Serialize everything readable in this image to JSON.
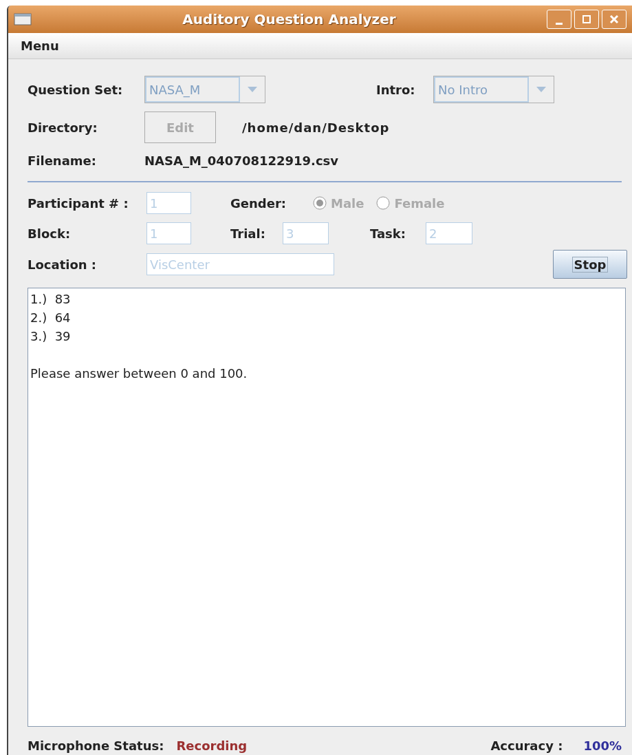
{
  "window": {
    "title": "Auditory Question Analyzer"
  },
  "menu": [
    "Menu"
  ],
  "question_set": {
    "label": "Question Set:",
    "value": "NASA_M",
    "disabled": true
  },
  "intro": {
    "label": "Intro:",
    "value": "No Intro",
    "disabled": true
  },
  "directory": {
    "label": "Directory:",
    "button": "Edit",
    "button_disabled": true,
    "path": "/home/dan/Desktop"
  },
  "filename": {
    "label": "Filename:",
    "value": "NASA_M_040708122919.csv"
  },
  "participant": {
    "label": "Participant # :",
    "value": "1",
    "disabled": true
  },
  "gender": {
    "label": "Gender:",
    "disabled": true,
    "options": [
      {
        "label": "Male",
        "selected": true
      },
      {
        "label": "Female",
        "selected": false
      }
    ]
  },
  "block": {
    "label": "Block:",
    "value": "1",
    "disabled": true
  },
  "trial": {
    "label": "Trial:",
    "value": "3",
    "disabled": true
  },
  "task": {
    "label": "Task:",
    "value": "2",
    "disabled": true
  },
  "location": {
    "label": "Location :",
    "value": "VisCenter",
    "disabled": true
  },
  "stop_button": "Stop",
  "output": {
    "lines": [
      "1.)  83",
      "2.)  64",
      "3.)  39"
    ],
    "message": "Please answer between 0 and 100."
  },
  "status": {
    "label": "Microphone Status:",
    "value": "Recording",
    "accuracy_label": "Accuracy :",
    "accuracy": "100%"
  }
}
